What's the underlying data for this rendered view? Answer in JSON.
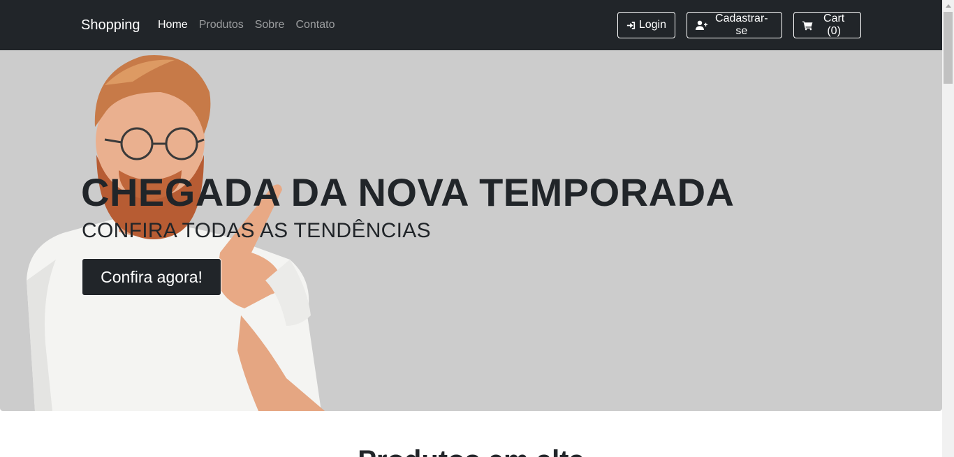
{
  "navbar": {
    "brand": "Shopping",
    "links": [
      "Home",
      "Produtos",
      "Sobre",
      "Contato"
    ],
    "login_label": "Login",
    "signup_label": "Cadastrar-se",
    "cart_label": "Cart (0)"
  },
  "hero": {
    "title": "CHEGADA DA NOVA TEMPORADA",
    "subtitle": "CONFIRA TODAS AS TENDÊNCIAS",
    "cta_label": "Confira agora!"
  },
  "section": {
    "title": "Produtos em alta"
  },
  "icons": {
    "login": "sign-in-icon",
    "signup": "user-plus-icon",
    "cart": "shopping-cart-icon"
  },
  "colors": {
    "navbar_bg": "#212529",
    "hero_bg": "#cccccc",
    "button_dark": "#212529"
  }
}
